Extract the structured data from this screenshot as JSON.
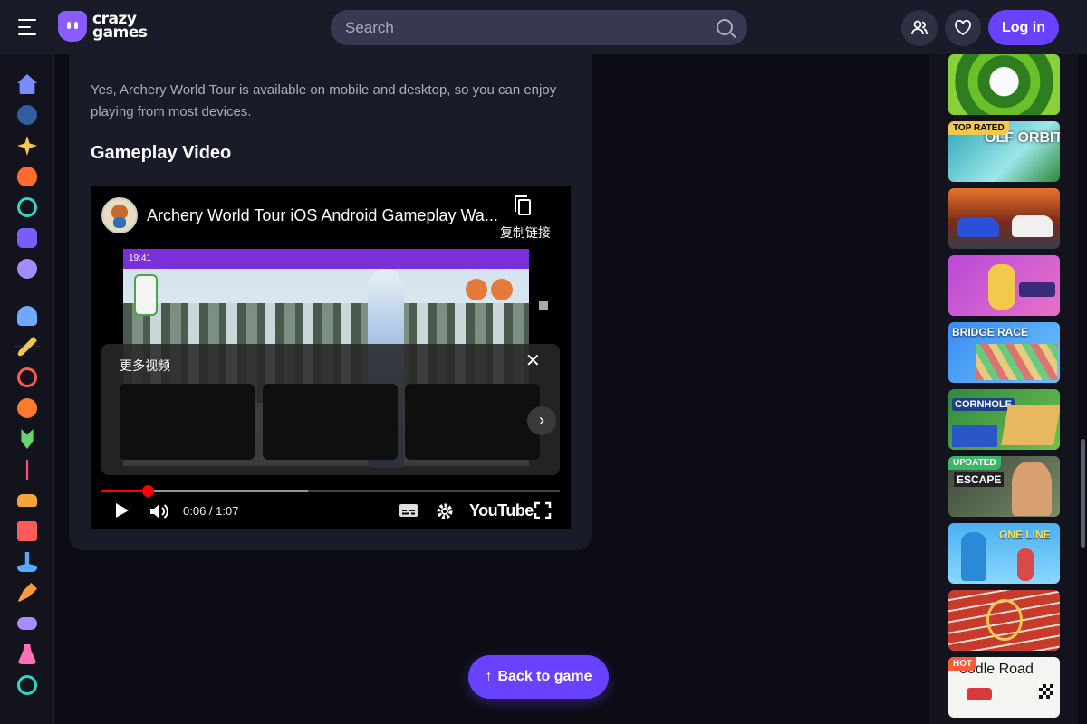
{
  "header": {
    "logo_line1": "crazy",
    "logo_line2": "games",
    "search_placeholder": "Search",
    "login_label": "Log in"
  },
  "sidebar": {
    "icons": [
      "home-icon",
      "recent-icon",
      "new-icon",
      "trending-icon",
      "updated-icon",
      "originals-icon",
      "multiplayer-icon",
      "two-player-icon",
      "action-icon",
      "adventure-icon",
      "basketball-icon",
      "casual-icon",
      "clicker-icon",
      "driving-icon",
      "card-icon",
      "io-icon",
      "shooting-icon",
      "controller-icon",
      "dress-up-icon",
      "puzzle-icon"
    ]
  },
  "content": {
    "faq_answer": "Yes, Archery World Tour is available on mobile and desktop, so you can enjoy playing from most devices.",
    "gameplay_heading": "Gameplay Video"
  },
  "video": {
    "title": "Archery World Tour iOS Android Gameplay Wa...",
    "copy_link_label": "复制链接",
    "phone_time": "19:41",
    "more_videos_label": "更多视频",
    "time_display": "0:06 / 1:07",
    "brand": "YouTube",
    "progress_played_fraction": 0.1,
    "progress_buffered_fraction": 0.45
  },
  "back_button_label": "Back to game",
  "rail": {
    "games": [
      {
        "name": "golf-ball-game",
        "title": "",
        "tag": ""
      },
      {
        "name": "golf-orbit",
        "title": "OLF ORBIT",
        "tag": "TOP RATED"
      },
      {
        "name": "racing-game",
        "title": "",
        "tag": ""
      },
      {
        "name": "basketball-game",
        "title": "",
        "tag": ""
      },
      {
        "name": "bridge-race",
        "title": "BRIDGE RACE",
        "tag": ""
      },
      {
        "name": "cornhole-league",
        "title": "CORNHOLE",
        "tag": ""
      },
      {
        "name": "escape-game",
        "title": "ESCAPE",
        "tag": "UPDATED"
      },
      {
        "name": "one-line",
        "title": "ONE LINE",
        "tag": ""
      },
      {
        "name": "track-race",
        "title": "",
        "tag": ""
      },
      {
        "name": "doodle-road",
        "title": "oodle Road",
        "tag": "HOT"
      }
    ]
  },
  "colors": {
    "accent": "#6842ff",
    "topbar": "#1a1b28",
    "background": "#0c0d14",
    "progress": "#ff0000"
  }
}
